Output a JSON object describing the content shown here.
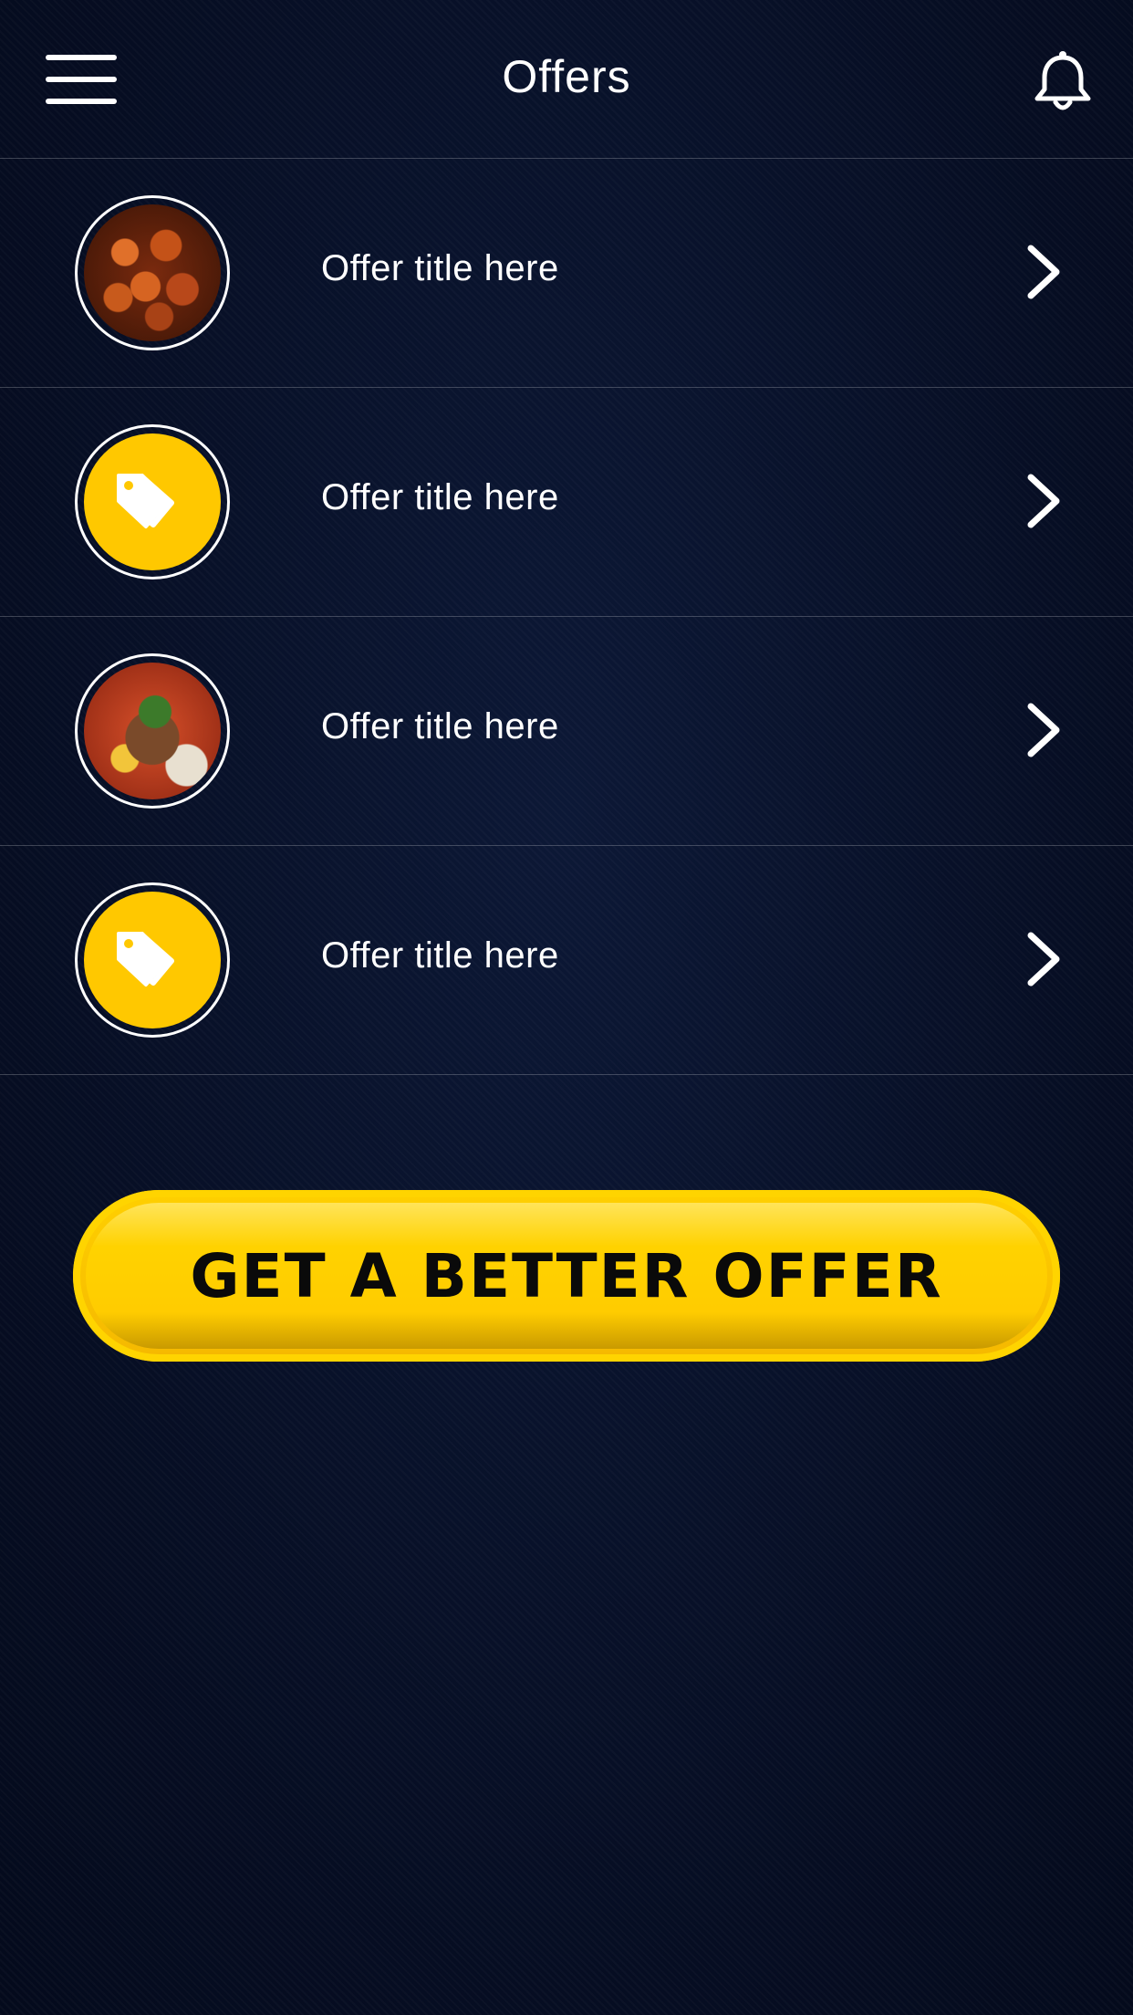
{
  "header": {
    "title": "Offers"
  },
  "offers": [
    {
      "label": "Offer title here",
      "thumbnail": "food-image",
      "icon": "chevron-right-icon"
    },
    {
      "label": "Offer title here",
      "thumbnail": "tag-icon",
      "icon": "chevron-right-icon"
    },
    {
      "label": "Offer title here",
      "thumbnail": "food-image",
      "icon": "chevron-right-icon"
    },
    {
      "label": "Offer title here",
      "thumbnail": "tag-icon",
      "icon": "chevron-right-icon"
    }
  ],
  "cta": {
    "label": "GET A BETTER OFFER"
  },
  "colors": {
    "background": "#07102a",
    "accent": "#ffc800",
    "text": "#ffffff"
  }
}
